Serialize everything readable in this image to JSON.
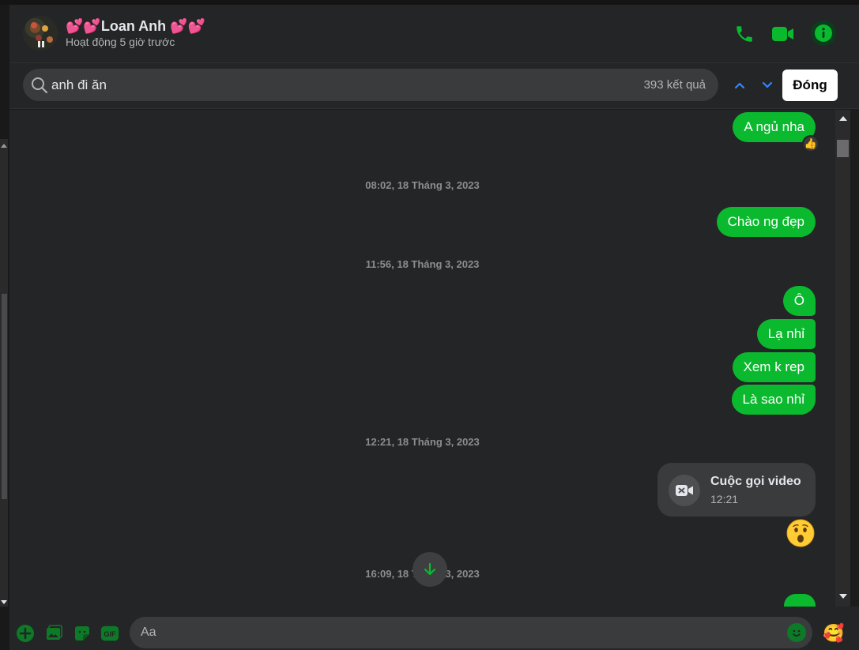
{
  "header": {
    "contact_name": "💕💕Loan Anh 💕💕",
    "status": "Hoạt động 5 giờ trước",
    "accent_color": "#0ab92e"
  },
  "search": {
    "query": "anh đi ăn",
    "result_count": "393 kết quả",
    "close_label": "Đóng"
  },
  "messages": [
    {
      "type": "bubble",
      "text": "A ngủ nha",
      "reaction": "👍"
    },
    {
      "type": "timestamp",
      "text": "08:02, 18 Tháng 3, 2023"
    },
    {
      "type": "bubble",
      "text": "Chào ng đẹp"
    },
    {
      "type": "timestamp",
      "text": "11:56, 18 Tháng 3, 2023"
    },
    {
      "type": "bubble",
      "text": "Ô"
    },
    {
      "type": "bubble",
      "text": "Lạ nhỉ"
    },
    {
      "type": "bubble",
      "text": "Xem k rep"
    },
    {
      "type": "bubble",
      "text": "Là sao nhỉ"
    },
    {
      "type": "timestamp",
      "text": "12:21, 18 Tháng 3, 2023"
    },
    {
      "type": "call",
      "title": "Cuộc gọi video",
      "time": "12:21"
    },
    {
      "type": "emoji",
      "text": "😮"
    },
    {
      "type": "timestamp",
      "text": "16:09, 18 Tháng 3, 2023"
    }
  ],
  "composer": {
    "placeholder": "Aa",
    "gif_label": "GIF",
    "reaction_emoji": "🥰"
  }
}
